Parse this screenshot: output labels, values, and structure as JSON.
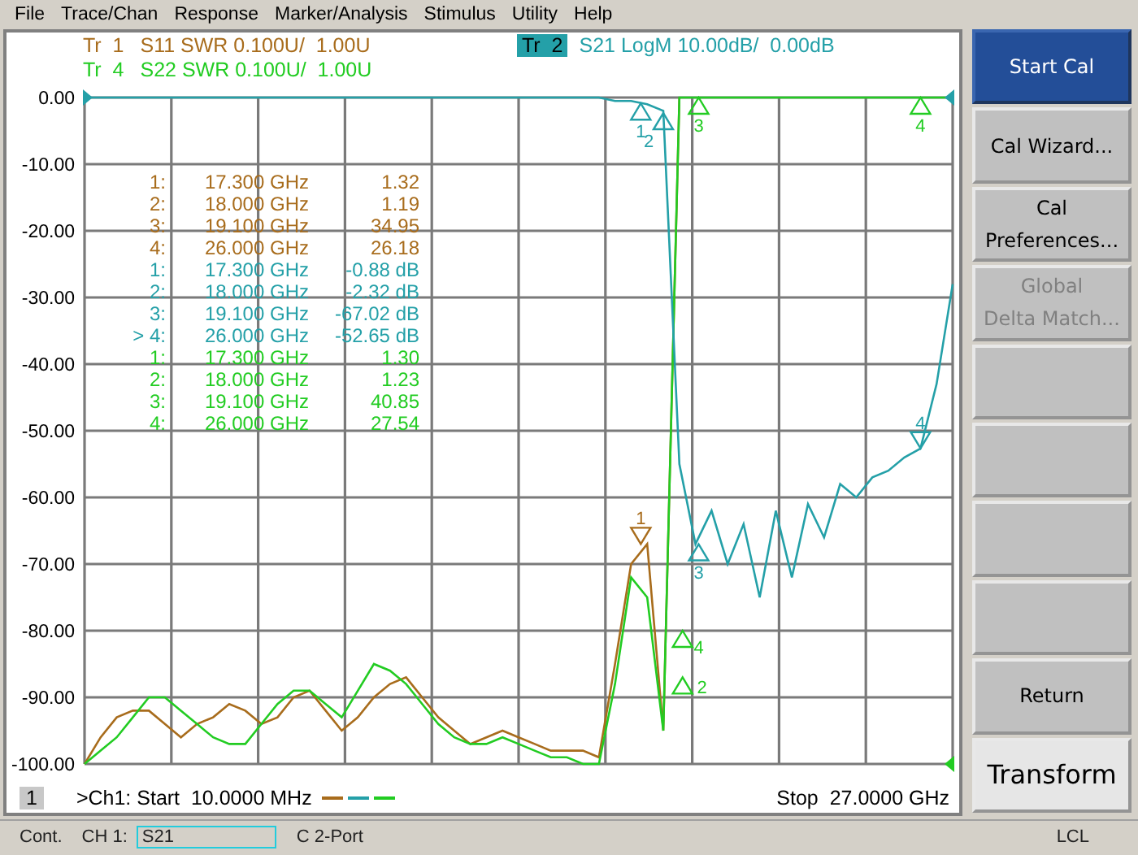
{
  "menu": [
    "File",
    "Trace/Chan",
    "Response",
    "Marker/Analysis",
    "Stimulus",
    "Utility",
    "Help"
  ],
  "legends": [
    {
      "label": "Tr  1",
      "text": "S11 SWR 0.100U/  1.00U",
      "color": "#a86c1c",
      "selected": false
    },
    {
      "label": "Tr  2",
      "text": "S21 LogM 10.00dB/  0.00dB",
      "color": "#24a0a8",
      "selected": true
    },
    {
      "label": "Tr  4",
      "text": "S22 SWR 0.100U/  1.00U",
      "color": "#22cc22",
      "selected": false
    }
  ],
  "plot": {
    "chart_data": {
      "type": "line",
      "ylim": [
        -100,
        0
      ],
      "grid": true,
      "categories": [
        null,
        null,
        null,
        null,
        null,
        null,
        null,
        null,
        null,
        null,
        null,
        null,
        null,
        null,
        null,
        null,
        null,
        null,
        null,
        null,
        null,
        null,
        null,
        null,
        null,
        null,
        null,
        null,
        null,
        null,
        null,
        null,
        null,
        null,
        null,
        null,
        null,
        null,
        null,
        null,
        null,
        null,
        null,
        null,
        null,
        null,
        null,
        null,
        null,
        null,
        null,
        null,
        null,
        null,
        null
      ],
      "yticks": [
        {
          "value": 0,
          "label": "0.00"
        },
        {
          "value": -10,
          "label": "-10.00"
        },
        {
          "value": -20,
          "label": "-20.00"
        },
        {
          "value": -30,
          "label": "-30.00"
        },
        {
          "value": -40,
          "label": "-40.00"
        },
        {
          "value": -50,
          "label": "-50.00"
        },
        {
          "value": -60,
          "label": "-60.00"
        },
        {
          "value": -70,
          "label": "-70.00"
        },
        {
          "value": -80,
          "label": "-80.00"
        },
        {
          "value": -90,
          "label": "-90.00"
        },
        {
          "value": -100,
          "label": "-100.00"
        }
      ],
      "series": [
        {
          "color": "#a86c1c",
          "values": [
            -100,
            -96,
            -93,
            -92,
            -92,
            -94,
            -96,
            -94,
            -93,
            -91,
            -92,
            -94,
            -93,
            -90,
            -89,
            -92,
            -95,
            -93,
            -90,
            -88,
            -87,
            -90,
            -93,
            -95,
            -97,
            -96,
            -95,
            -96,
            -97,
            -98,
            -98,
            -98,
            -99,
            -85,
            -70,
            -67,
            -95,
            0,
            null,
            null,
            null,
            null,
            null,
            null,
            null,
            null,
            null,
            null,
            null,
            null,
            null,
            null,
            null,
            null,
            null
          ]
        },
        {
          "color": "#24a0a8",
          "values": [
            0,
            0,
            0,
            0,
            0,
            0,
            0,
            0,
            0,
            0,
            0,
            0,
            0,
            0,
            0,
            0,
            0,
            0,
            0,
            0,
            0,
            0,
            0,
            0,
            0,
            0,
            0,
            0,
            0,
            0,
            0,
            0,
            0,
            -0.5,
            -0.5,
            -1,
            -2,
            -55,
            -67,
            -62,
            -70,
            -64,
            -75,
            -62,
            -72,
            -61,
            -66,
            -58,
            -60,
            -57,
            -56,
            -54,
            -52.65,
            -43,
            -28
          ]
        },
        {
          "color": "#22cc22",
          "values": [
            -100,
            -98,
            -96,
            -93,
            -90,
            -90,
            -92,
            -94,
            -96,
            -97,
            -97,
            -94,
            -91,
            -89,
            -89,
            -91,
            -93,
            -89,
            -85,
            -86,
            -88,
            -91,
            -94,
            -96,
            -97,
            -97,
            -96,
            -97,
            -98,
            -99,
            -99,
            -100,
            -100,
            -88,
            -72,
            -75,
            -95,
            0,
            0,
            0,
            0,
            0,
            0,
            0,
            0,
            0,
            0,
            0,
            0,
            0,
            0,
            0,
            0,
            0,
            0
          ]
        }
      ]
    },
    "markers": [
      {
        "label": "1",
        "color": "#24a0a8"
      },
      {
        "label": "2",
        "color": "#24a0a8"
      },
      {
        "label": "3",
        "color": "#24a0a8"
      },
      {
        "label": "4",
        "color": "#24a0a8"
      },
      {
        "label": "1",
        "color": "#a86c1c"
      },
      {
        "label": "3",
        "color": "#22cc22"
      },
      {
        "label": "4",
        "color": "#22cc22"
      },
      {
        "label": "4",
        "color": "#22cc22"
      },
      {
        "label": "2",
        "color": "#22cc22"
      }
    ],
    "readout": [
      {
        "color": "#a86c1c",
        "number": "1:",
        "freq": "17.300 GHz",
        "value": "1.32"
      },
      {
        "color": "#a86c1c",
        "number": "2:",
        "freq": "18.000 GHz",
        "value": "1.19"
      },
      {
        "color": "#a86c1c",
        "number": "3:",
        "freq": "19.100 GHz",
        "value": "34.95"
      },
      {
        "color": "#a86c1c",
        "number": "4:",
        "freq": "26.000 GHz",
        "value": "26.18"
      },
      {
        "color": "#24a0a8",
        "number": "1:",
        "freq": "17.300 GHz",
        "value": "-0.88 dB"
      },
      {
        "color": "#24a0a8",
        "number": "2:",
        "freq": "18.000 GHz",
        "value": "-2.32 dB"
      },
      {
        "color": "#24a0a8",
        "number": "3:",
        "freq": "19.100 GHz",
        "value": "-67.02 dB"
      },
      {
        "color": "#24a0a8",
        "number": "> 4:",
        "freq": "26.000 GHz",
        "value": "-52.65 dB"
      },
      {
        "color": "#22cc22",
        "number": "1:",
        "freq": "17.300 GHz",
        "value": "1.30"
      },
      {
        "color": "#22cc22",
        "number": "2:",
        "freq": "18.000 GHz",
        "value": "1.23"
      },
      {
        "color": "#22cc22",
        "number": "3:",
        "freq": "19.100 GHz",
        "value": "40.85"
      },
      {
        "color": "#22cc22",
        "number": "4:",
        "freq": "26.000 GHz",
        "value": "27.54"
      }
    ]
  },
  "footer": {
    "channel": "1",
    "start": ">Ch1: Start  10.0000 MHz",
    "stop": "Stop  27.0000 GHz"
  },
  "softkeys": [
    {
      "kind": "primary",
      "label": "Start Cal"
    },
    {
      "kind": "normal",
      "label": "Cal Wizard..."
    },
    {
      "kind": "normal",
      "label": "Cal\nPreferences..."
    },
    {
      "kind": "disabled",
      "label": "Global\nDelta Match..."
    },
    {
      "kind": "blank"
    },
    {
      "kind": "blank"
    },
    {
      "kind": "blank"
    },
    {
      "kind": "blank"
    },
    {
      "kind": "normal",
      "label": "Return"
    },
    {
      "kind": "light",
      "label": "Transform"
    }
  ],
  "status_bar": {
    "mode": "Cont.",
    "channel": "CH 1:",
    "measurement": "S21",
    "cal": "C  2-Port",
    "remote": "LCL"
  }
}
